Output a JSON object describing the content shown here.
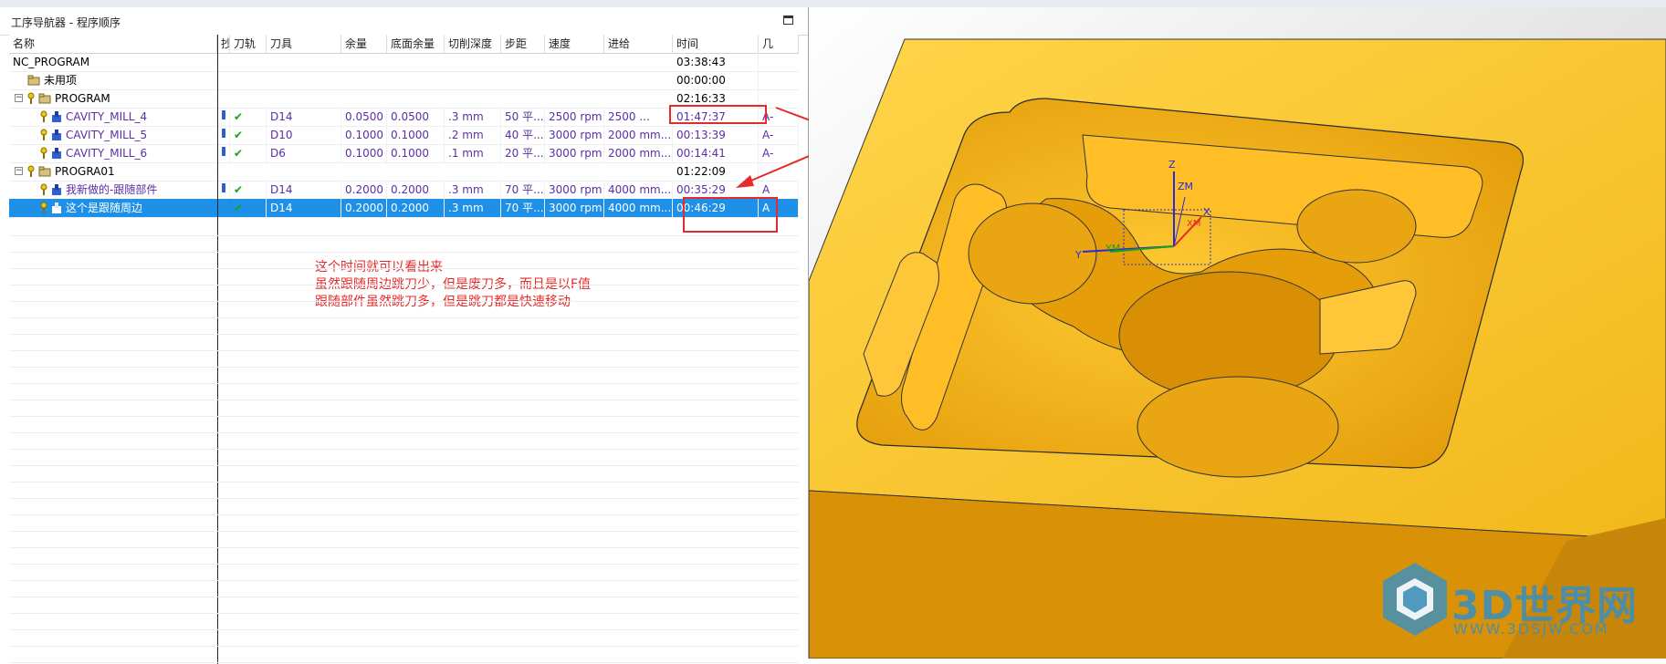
{
  "panel": {
    "title": "工序导航器 - 程序顺序"
  },
  "columns": [
    "名称",
    "抄",
    "刀轨",
    "刀具",
    "余量",
    "底面余量",
    "切削深度",
    "步距",
    "速度",
    "进给",
    "时间",
    "几"
  ],
  "rows": [
    {
      "name": "NC_PROGRAM",
      "time": "03:38:43"
    },
    {
      "name": "未用项",
      "time": "00:00:00"
    },
    {
      "name": "PROGRAM",
      "time": "02:16:33"
    },
    {
      "name": "CAVITY_MILL_4",
      "tool": "D14",
      "stock": "0.0500",
      "floor_stock": "0.0500",
      "depth": ".3 mm",
      "stepover": "50 平...",
      "speed": "2500 rpm",
      "feed": "2500 ...",
      "time": "01:47:37",
      "geom": "A-"
    },
    {
      "name": "CAVITY_MILL_5",
      "tool": "D10",
      "stock": "0.1000",
      "floor_stock": "0.1000",
      "depth": ".2 mm",
      "stepover": "40 平...",
      "speed": "3000 rpm",
      "feed": "2000 mm...",
      "time": "00:13:39",
      "geom": "A-"
    },
    {
      "name": "CAVITY_MILL_6",
      "tool": "D6",
      "stock": "0.1000",
      "floor_stock": "0.1000",
      "depth": ".1 mm",
      "stepover": "20 平...",
      "speed": "3000 rpm",
      "feed": "2000 mm...",
      "time": "00:14:41",
      "geom": "A-"
    },
    {
      "name": "PROGRA01",
      "time": "01:22:09"
    },
    {
      "name": "我新做的-跟随部件",
      "tool": "D14",
      "stock": "0.2000",
      "floor_stock": "0.2000",
      "depth": ".3 mm",
      "stepover": "70 平...",
      "speed": "3000 rpm",
      "feed": "4000 mm...",
      "time": "00:35:29",
      "geom": "A"
    },
    {
      "name": "这个是跟随周边",
      "tool": "D14",
      "stock": "0.2000",
      "floor_stock": "0.2000",
      "depth": ".3 mm",
      "stepover": "70 平...",
      "speed": "3000 rpm",
      "feed": "4000 mm...",
      "time": "00:46:29",
      "geom": "A"
    }
  ],
  "annotation": {
    "line1": "这个时间就可以看出来",
    "line2": "虽然跟随周边跳刀少，但是废刀多，而且是以F值",
    "line3": "跟随部件虽然跳刀多，但是跳刀都是快速移动"
  },
  "axes": {
    "z": "Z",
    "zm": "ZM",
    "y": "Y",
    "ym": "YM",
    "x": "X",
    "xm": "XM"
  },
  "watermark": {
    "title": "3D世界网",
    "url": "WWW.3DSJW.COM"
  },
  "colors": {
    "accent_red": "#e42b2b",
    "selection_blue": "#1e90e8",
    "op_purple": "#5a2ea6",
    "part_yellow": "#f2b81a"
  }
}
